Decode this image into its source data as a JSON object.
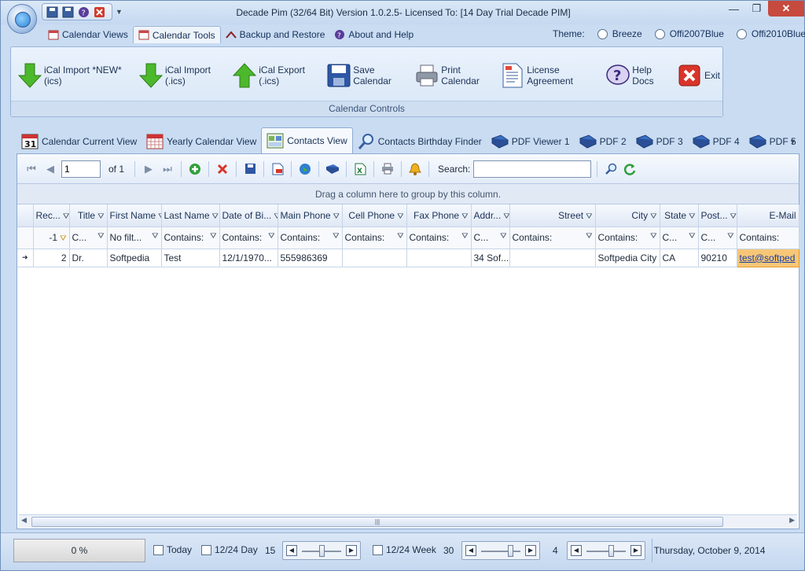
{
  "window": {
    "title": "Decade Pim (32/64 Bit) Version 1.0.2.5- Licensed To: [14 Day Trial Decade PIM]"
  },
  "ribbon_tabs": [
    {
      "label": "Calendar Views",
      "icon": "calendar-icon"
    },
    {
      "label": "Calendar Tools",
      "icon": "calendar-tools-icon"
    },
    {
      "label": "Backup and Restore",
      "icon": "backup-icon"
    },
    {
      "label": "About and Help",
      "icon": "help-icon"
    }
  ],
  "theme": {
    "label": "Theme:",
    "options": [
      "Breeze",
      "Offi2007Blue",
      "Offi2010Blue"
    ]
  },
  "ribbon_group": {
    "label": "Calendar Controls",
    "buttons": [
      {
        "label": "iCal Import *NEW* (ics)",
        "icon": "green-down-arrow-icon"
      },
      {
        "label": "iCal Import (.ics)",
        "icon": "green-down-arrow-icon"
      },
      {
        "label": "iCal Export (.ics)",
        "icon": "green-up-arrow-icon"
      },
      {
        "label": "Save Calendar",
        "icon": "floppy-disk-icon"
      },
      {
        "label": "Print Calendar",
        "icon": "printer-icon"
      },
      {
        "label": "License Agreement",
        "icon": "document-icon"
      },
      {
        "label": "Help Docs",
        "icon": "question-icon"
      },
      {
        "label": "Exit",
        "icon": "red-x-icon"
      }
    ]
  },
  "content_tabs": [
    {
      "label": "Calendar Current View",
      "icon": "calendar-31-icon"
    },
    {
      "label": "Yearly Calendar View",
      "icon": "yearly-calendar-icon"
    },
    {
      "label": "Contacts View",
      "icon": "contacts-icon"
    },
    {
      "label": "Contacts Birthday Finder",
      "icon": "magnifier-icon"
    },
    {
      "label": "PDF Viewer 1",
      "icon": "book-icon"
    },
    {
      "label": "PDF 2",
      "icon": "book-icon"
    },
    {
      "label": "PDF 3",
      "icon": "book-icon"
    },
    {
      "label": "PDF 4",
      "icon": "book-icon"
    },
    {
      "label": "PDF 5",
      "icon": "book-icon"
    }
  ],
  "navigator": {
    "page": "1",
    "of_label": "of 1",
    "search_label": "Search:"
  },
  "grid": {
    "group_hint": "Drag a column here to group by this column.",
    "headers": [
      "Rec...",
      "Title",
      "First Name",
      "Last Name",
      "Date of Bi...",
      "Main Phone",
      "Cell Phone",
      "Fax Phone",
      "Addr...",
      "Street",
      "City",
      "State",
      "Post...",
      "E-Mail"
    ],
    "filters": [
      "-1",
      "C...",
      "No filt...",
      "Contains:",
      "Contains:",
      "Contains:",
      "Contains:",
      "Contains:",
      "C...",
      "Contains:",
      "Contains:",
      "C...",
      "C...",
      "Contains:"
    ],
    "rows": [
      [
        "2",
        "Dr.",
        "Softpedia",
        "Test",
        "12/1/1970...",
        "555986369",
        "",
        "",
        "34 Sof...",
        "",
        "Softpedia City",
        "CA",
        "90210",
        "test@softped"
      ]
    ]
  },
  "status": {
    "progress": "0 %",
    "today": "Today",
    "day_toggle": "12/24 Day",
    "day_value": "15",
    "week_toggle": "12/24 Week",
    "week_value": "30",
    "third_value": "4",
    "date": "Thursday, October 9, 2014"
  }
}
